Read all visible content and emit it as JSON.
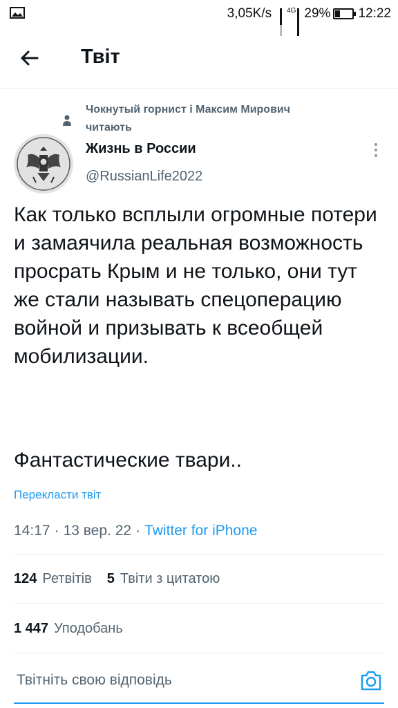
{
  "status_bar": {
    "speed": "3,05K/s",
    "network": "4G",
    "battery": "29%",
    "battery_level": 0.29,
    "time": "12:22"
  },
  "header": {
    "title": "Твіт"
  },
  "tweet": {
    "social_context": "Чокнутый горнист і Максим Мирович\nчитають",
    "author_name": "Жизнь в России",
    "author_handle": "@RussianLife2022",
    "text": "Как только всплыли огромные потери и замаячила реальная возможность просрать Крым и не только, они тут же стали называть спецоперацию войной и призывать к всеобщей мобилизации.",
    "text_2": "Фантастические твари..",
    "translate_label": "Перекласти твіт",
    "time": "14:17",
    "date": "13 вер. 22",
    "source": "Twitter for iPhone"
  },
  "stats": {
    "retweets_count": "124",
    "retweets_label": "Ретвітів",
    "quotes_count": "5",
    "quotes_label": "Твіти з цитатою",
    "likes_count": "1 447",
    "likes_label": "Уподобань"
  },
  "reply": {
    "placeholder": "Твітніть свою відповідь"
  },
  "icons": {
    "back": "arrow-left-icon",
    "camera": "camera-icon",
    "more": "more-vertical-icon",
    "person": "person-icon",
    "image": "image-icon"
  },
  "colors": {
    "accent": "#1d9bf0",
    "secondary_text": "#536471",
    "primary_text": "#0f1419"
  }
}
